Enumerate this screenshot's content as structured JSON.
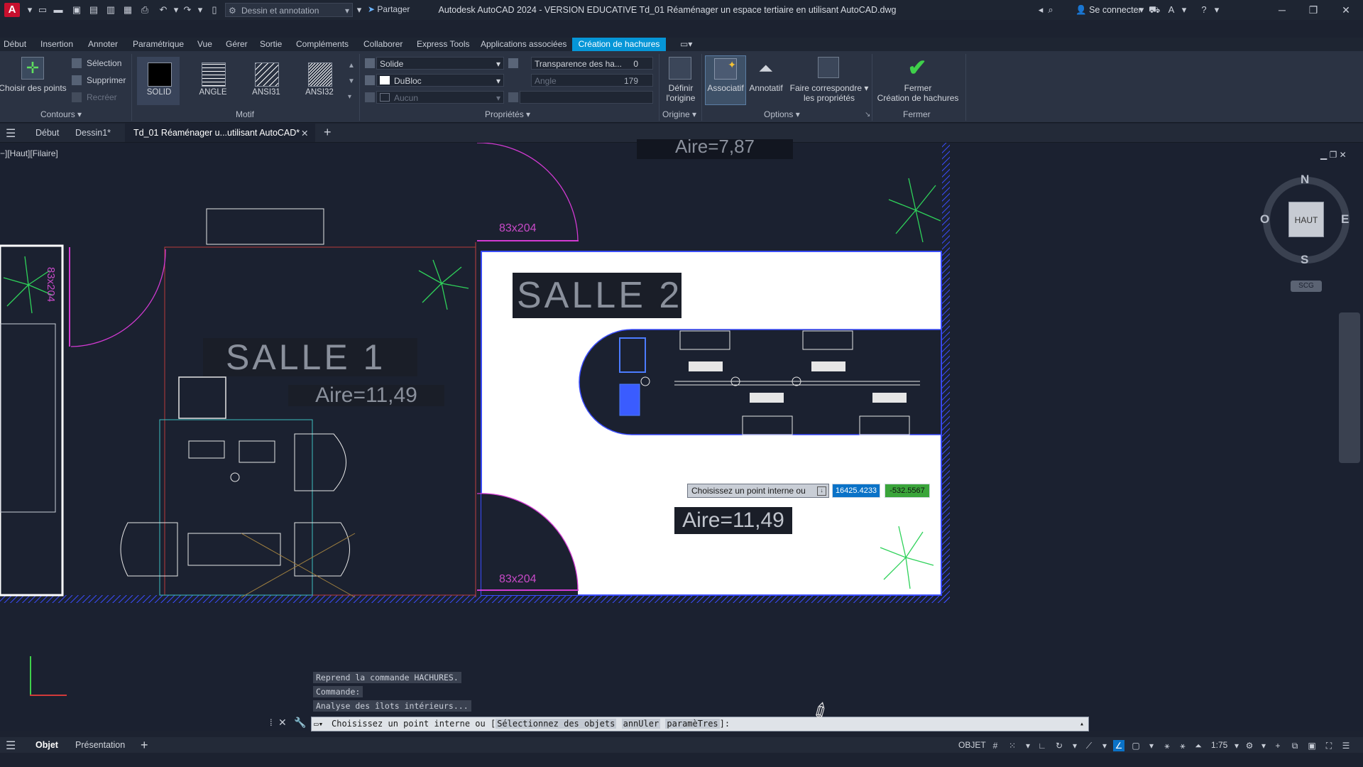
{
  "titlebar": {
    "app_logo": "A",
    "workspace": "Dessin et annotation",
    "share": "Partager",
    "title": "Autodesk AutoCAD 2024 - VERSION EDUCATIVE   Td_01 Réaménager un espace tertiaire en utilisant AutoCAD.dwg",
    "sign_in": "Se connecter"
  },
  "menu": {
    "items": [
      "Début",
      "Insertion",
      "Annoter",
      "Paramétrique",
      "Vue",
      "Gérer",
      "Sortie",
      "Compléments",
      "Collaborer",
      "Express Tools",
      "Applications associées"
    ],
    "active": "Création de hachures"
  },
  "ribbon": {
    "contours": {
      "title": "Contours",
      "pick_points": "Choisir des points",
      "selection": "Sélection",
      "remove": "Supprimer",
      "recreate": "Recréer"
    },
    "motif": {
      "title": "Motif",
      "patterns": [
        "SOLID",
        "ANGLE",
        "ANSI31",
        "ANSI32"
      ]
    },
    "proprietes": {
      "title": "Propriétés",
      "type": "Solide",
      "color": "DuBloc",
      "background": "Aucun",
      "transparency_label": "Transparence des ha...",
      "transparency_value": "0",
      "angle_label": "Angle",
      "angle_value": "179"
    },
    "origine": {
      "title": "Origine",
      "set_origin_line1": "Définir",
      "set_origin_line2": "l'origine"
    },
    "options": {
      "title": "Options",
      "associative": "Associatif",
      "annotative": "Annotatif",
      "match_line1": "Faire correspondre",
      "match_line2": "les propriétés"
    },
    "fermer": {
      "title": "Fermer",
      "close_line1": "Fermer",
      "close_line2": "Création de hachures"
    }
  },
  "doctabs": {
    "start": "Début",
    "drawing1": "Dessin1*",
    "active": "Td_01 Réaménager u...utilisant AutoCAD*"
  },
  "canvas": {
    "view_label": "−][Haut][Filaire]",
    "labels": {
      "salle1": "SALLE 1",
      "salle2": "SALLE 2",
      "area_top": "Aire=7,87",
      "area1": "Aire=11,49",
      "area2": "Aire=11,49",
      "door_top": "83x204",
      "door_bottom": "83x204",
      "door_left": "83x204"
    },
    "dynamic_input": {
      "prompt": "Choisissez un point interne ou",
      "x": "16425.4233",
      "y": "-532.5567"
    },
    "viewcube": {
      "top": "HAUT",
      "n": "N",
      "s": "S",
      "e": "E",
      "w": "O",
      "ucs": "SCG"
    }
  },
  "command": {
    "history": [
      "Reprend la commande HACHURES.",
      "Commande:",
      "Analyse des îlots intérieurs..."
    ],
    "prompt": "Choisissez un point interne ou [",
    "options": [
      "Sélectionnez des objets",
      "annUler",
      "paramèTres"
    ],
    "prompt_end": "]:"
  },
  "statusbar": {
    "model": "Objet",
    "layout": "Présentation",
    "mode": "OBJET",
    "scale": "1:75"
  },
  "colors": {
    "accent": "#0696d7",
    "wall": "#3a4cff",
    "plant": "#2fd25a",
    "door": "#d23ad2"
  }
}
